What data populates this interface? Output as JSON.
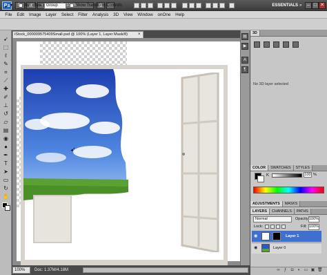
{
  "titlebar": {
    "logo": "Ps",
    "zoom": "100%",
    "workspace": "ESSENTIALS",
    "minimize": "–",
    "maximize": "□",
    "close": "✕"
  },
  "menu": [
    "File",
    "Edit",
    "Image",
    "Layer",
    "Select",
    "Filter",
    "Analysis",
    "3D",
    "View",
    "Window",
    "onOne",
    "Help"
  ],
  "options": {
    "auto_select_label": "Auto-Select:",
    "auto_select_value": "Group",
    "show_transform_label": "Show Transform Controls"
  },
  "document": {
    "tab_title": "iStock_000009575409Small.psd @ 100% (Layer 1, Layer Mask/8)",
    "tab_close": "×",
    "status_zoom": "100%",
    "status_doc": "Doc: 1.37M/4.18M"
  },
  "panels": {
    "panel_3d_tab": "3D",
    "no_3d": "No 3D layer selected",
    "color_tabs": [
      "COLOR",
      "SWATCHES",
      "STYLES"
    ],
    "color_channel": "K",
    "color_value": "100",
    "color_percent": "%",
    "adjust_tabs": [
      "ADJUSTMENTS",
      "MASKS"
    ],
    "layers_tabs": [
      "LAYERS",
      "CHANNELS",
      "PATHS"
    ],
    "blend_mode": "Normal",
    "opacity_label": "Opacity:",
    "opacity_value": "100%",
    "lock_label": "Lock:",
    "fill_label": "Fill:",
    "fill_value": "100%",
    "layers": [
      {
        "name": "Layer 1",
        "selected": true
      },
      {
        "name": "Layer 0",
        "selected": false
      }
    ]
  },
  "colors": {
    "layer_selected": "#3f6fcf",
    "sky_blue": "#2b59c7",
    "grass_green": "#5aa032",
    "app_dark": "#4a4a4a"
  }
}
